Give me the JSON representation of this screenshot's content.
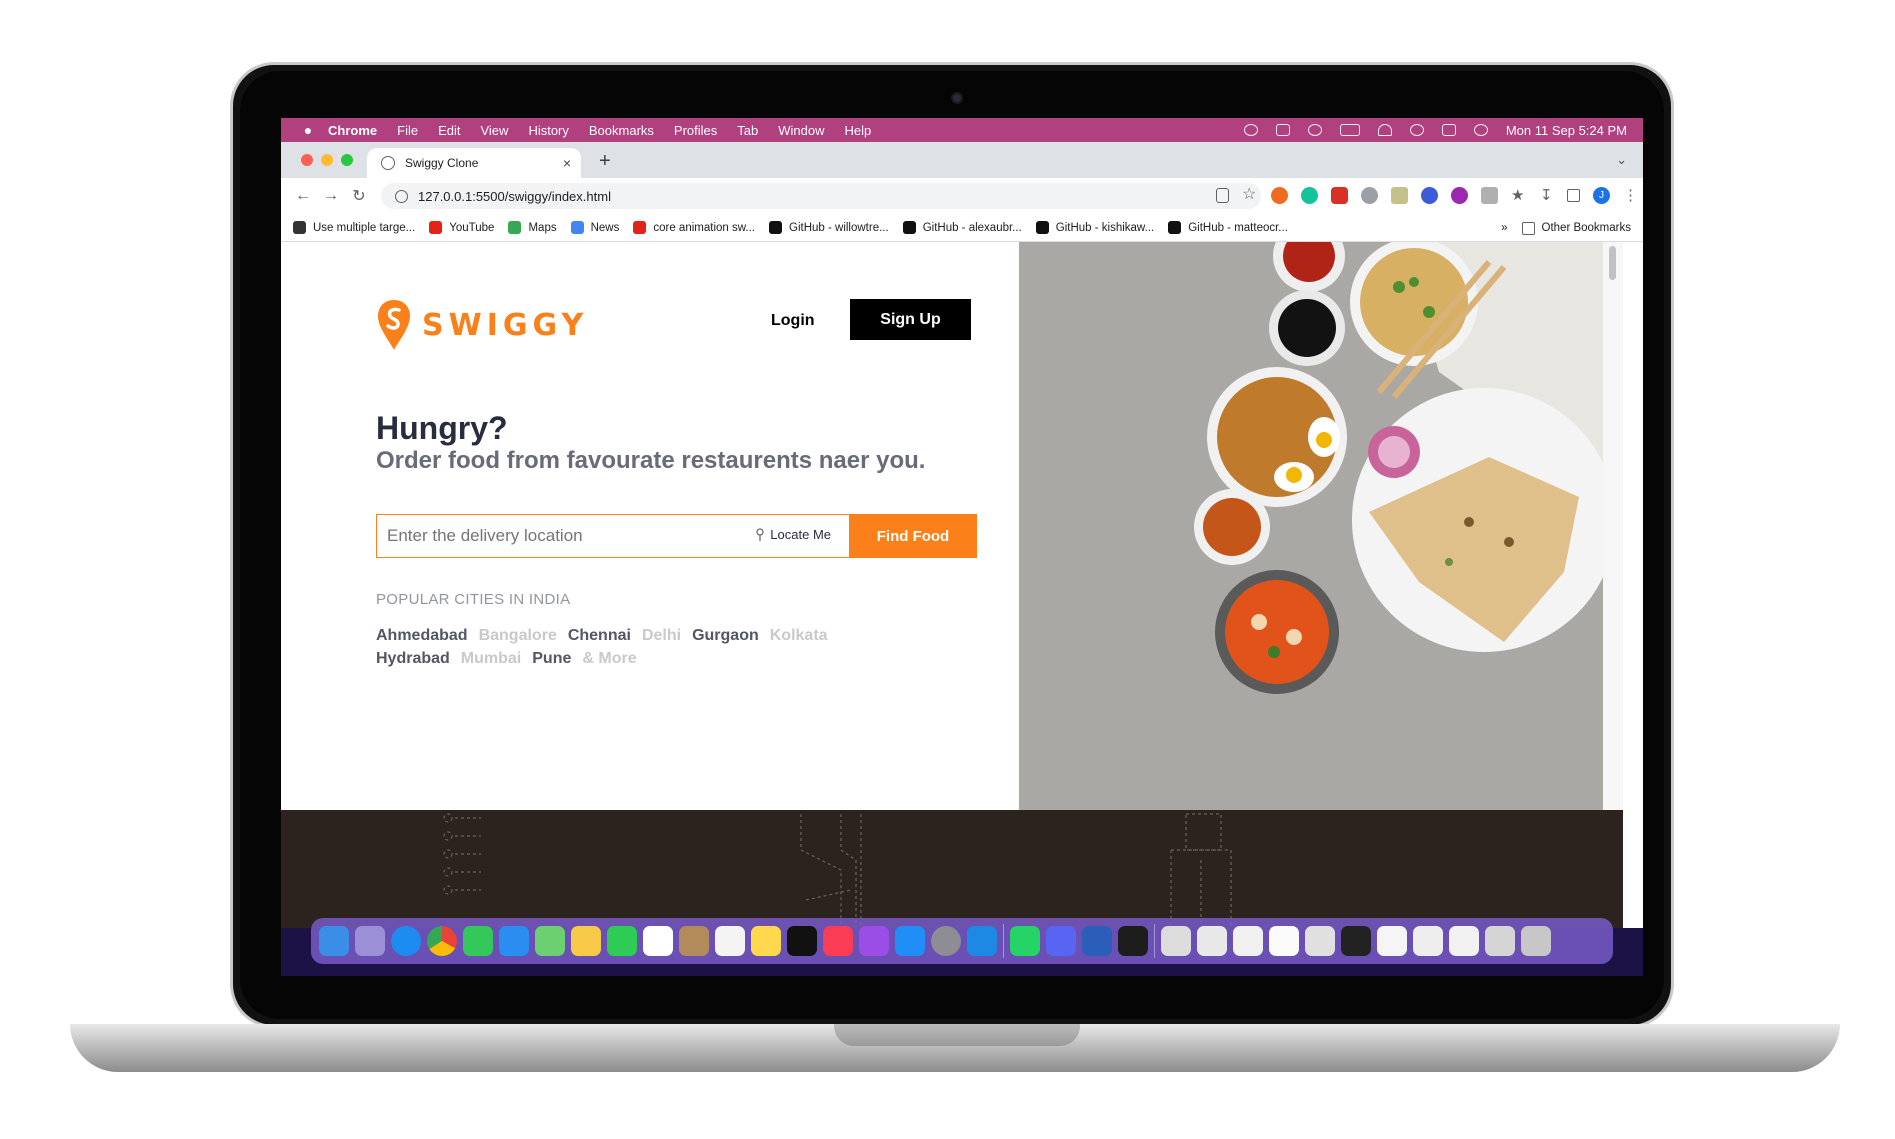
{
  "menubar": {
    "items": [
      "Chrome",
      "File",
      "Edit",
      "View",
      "History",
      "Bookmarks",
      "Profiles",
      "Tab",
      "Window",
      "Help"
    ],
    "clock": "Mon 11 Sep  5:24 PM"
  },
  "browser": {
    "tab_title": "Swiggy Clone",
    "tab_close": "×",
    "new_tab": "+",
    "url": "127.0.0.1:5500/swiggy/index.html",
    "bookmarks": [
      {
        "label": "Use multiple targe...",
        "color": "#333333"
      },
      {
        "label": "YouTube",
        "color": "#e62117"
      },
      {
        "label": "Maps",
        "color": "#34a853"
      },
      {
        "label": "News",
        "color": "#4285f4"
      },
      {
        "label": "core animation sw...",
        "color": "#e62117"
      },
      {
        "label": "GitHub - willowtre...",
        "color": "#111111"
      },
      {
        "label": "GitHub - alexaubr...",
        "color": "#111111"
      },
      {
        "label": "GitHub - kishikaw...",
        "color": "#111111"
      },
      {
        "label": "GitHub - matteocr...",
        "color": "#111111"
      }
    ],
    "bookmarks_overflow": "»",
    "other_bookmarks": "Other Bookmarks",
    "profile_initial": "J"
  },
  "page": {
    "logo": "SWIGGY",
    "login": "Login",
    "signup": "Sign Up",
    "headline": "Hungry?",
    "subline": "Order food from favourate restaurents naer you.",
    "search_placeholder": "Enter the delivery location",
    "locate": "Locate Me",
    "find_food": "Find Food",
    "cities_label": "POPULAR CITIES IN INDIA",
    "cities": [
      {
        "name": "Ahmedabad",
        "tone": "dark"
      },
      {
        "name": "Bangalore",
        "tone": "light"
      },
      {
        "name": "Chennai",
        "tone": "dark"
      },
      {
        "name": "Delhi",
        "tone": "light"
      },
      {
        "name": "Gurgaon",
        "tone": "dark"
      },
      {
        "name": "Kolkata",
        "tone": "light"
      },
      {
        "name": "Hydrabad",
        "tone": "dark"
      },
      {
        "name": "Mumbai",
        "tone": "light"
      },
      {
        "name": "Pune",
        "tone": "dark"
      },
      {
        "name": "& More",
        "tone": "light"
      }
    ]
  },
  "colors": {
    "brand_orange": "#fc8019",
    "menubar": "#b1407f",
    "footer": "#2c221e"
  }
}
